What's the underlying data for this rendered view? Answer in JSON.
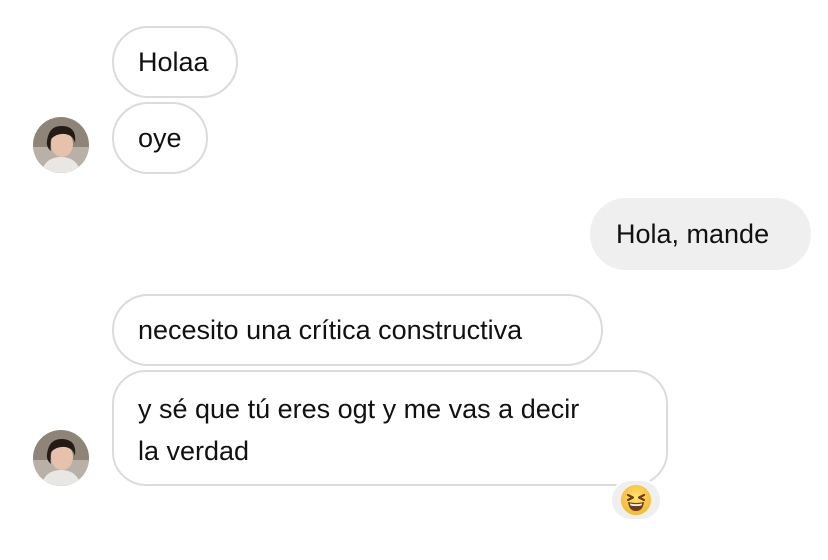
{
  "conversation": {
    "messages": [
      {
        "text": "Holaa",
        "sender": "them"
      },
      {
        "text": "oye",
        "sender": "them"
      },
      {
        "text": "Hola, mande",
        "sender": "me"
      },
      {
        "text": "necesito una crítica constructiva",
        "sender": "them"
      },
      {
        "text_line1": "y sé que tú eres ogt y me vas a decir",
        "text_line2": "la verdad",
        "sender": "them",
        "reaction": "grinning-squinting-face"
      }
    ]
  },
  "colors": {
    "incoming_border": "#dbdbdb",
    "outgoing_bg": "#efefef",
    "text": "#111111"
  }
}
